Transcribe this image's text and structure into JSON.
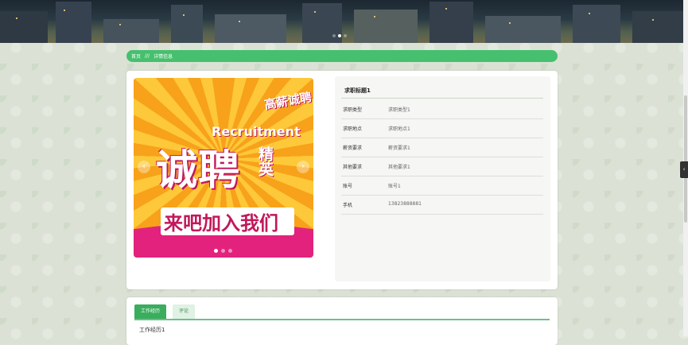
{
  "breadcrumb": {
    "home": "首页",
    "separator": "///",
    "current": "详情信息"
  },
  "banner": {
    "text_top": "高薪诚聘",
    "text_en": "Recruitment",
    "text_big": "诚聘",
    "text_side": "精英",
    "text_sub": "来吧加入我们",
    "prev_icon": "chevron-left-icon",
    "next_icon": "chevron-right-icon",
    "prev_glyph": "‹",
    "next_glyph": "›",
    "slide_count": 3,
    "active_slide": 1
  },
  "detail": {
    "title": "求职标题1",
    "fields": [
      {
        "label": "求职类型",
        "value": "求职类型1"
      },
      {
        "label": "求职地点",
        "value": "求职地点1"
      },
      {
        "label": "薪资要求",
        "value": "薪资要求1"
      },
      {
        "label": "其他要求",
        "value": "其他要求1"
      },
      {
        "label": "账号",
        "value": "账号1"
      },
      {
        "label": "手机",
        "value": "13823888881"
      }
    ]
  },
  "tabs": [
    {
      "label": "工作经历",
      "active": true
    },
    {
      "label": "评论",
      "active": false
    }
  ],
  "tab_content": "工作经历1",
  "side_button": {
    "icon": "chevron-left-icon",
    "glyph": "‹"
  },
  "colors": {
    "accent": "#46c06e",
    "tab_active": "#3aad5e",
    "banner_pink": "#e2227d",
    "banner_orange": "#f7a21a"
  }
}
